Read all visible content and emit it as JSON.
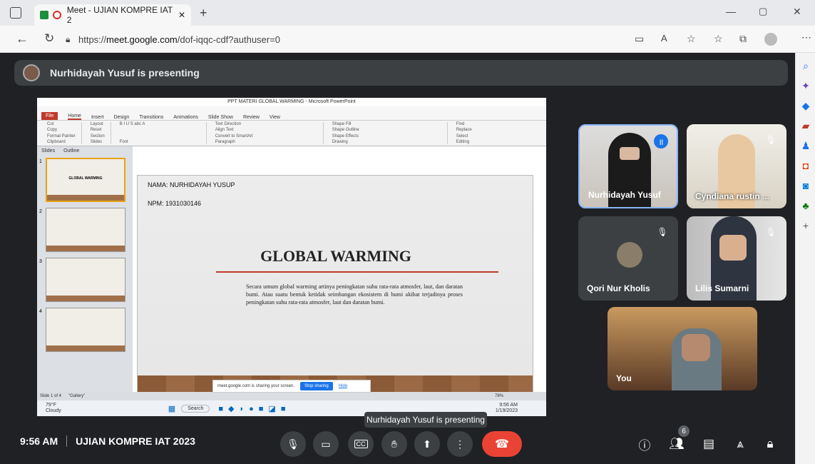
{
  "browser": {
    "tab_title": "Meet - UJIAN KOMPRE IAT 2",
    "url_prefix": "https://",
    "url_domain": "meet.google.com",
    "url_path": "/dof-iqqc-cdf?authuser=0"
  },
  "meet": {
    "presenter_banner": "Nurhidayah Yusuf is presenting",
    "time": "9:56 AM",
    "meeting_name": "UJIAN KOMPRE IAT 2023",
    "tooltip": "Nurhidayah Yusuf is presenting",
    "people_count": "6"
  },
  "participants": [
    {
      "name": "Nurhidayah Yusuf"
    },
    {
      "name": "Cyndiana rustin ..."
    },
    {
      "name": "Qori Nur Kholis"
    },
    {
      "name": "Lilis Sumarni"
    },
    {
      "name": "You"
    }
  ],
  "ppt": {
    "window_title": "PPT MATERI GLOBAL WARMING - Microsoft PowerPoint",
    "tabs": [
      "File",
      "Home",
      "Insert",
      "Design",
      "Transitions",
      "Animations",
      "Slide Show",
      "Review",
      "View"
    ],
    "groups": [
      "Clipboard",
      "Slides",
      "Font",
      "Paragraph",
      "Drawing",
      "Editing"
    ],
    "clipboard": [
      "Cut",
      "Copy",
      "Format Painter",
      "Paste"
    ],
    "slides_btns": [
      "Layout",
      "Reset",
      "Section",
      "New Slide"
    ],
    "drawing": [
      "Shape Fill",
      "Shape Outline",
      "Shape Effects",
      "Arrange",
      "Quick Styles"
    ],
    "editing": [
      "Find",
      "Replace",
      "Select"
    ],
    "paragraph": [
      "Text Direction",
      "Align Text",
      "Convert to SmartArt"
    ],
    "pane_tabs": [
      "Slides",
      "Outline"
    ],
    "slide_nums": [
      "1",
      "2",
      "3",
      "4"
    ],
    "thumb1_title": "GLOBAL WARMING",
    "slide_name": "NAMA: NURHIDAYAH YUSUP",
    "slide_npm": "NPM: 1931030146",
    "slide_title": "GLOBAL WARMING",
    "slide_body": "Secara umum global warming artinya peningkatan suhu rata-rata atmosfer, laut, dan daratan bumi. Atau suatu bentuk ketidak seimbangan ekosistem di bumi akibat terjadinya proses peningkatan suhu rata-rata atmosfer, laut dan daratan bumi.",
    "status_slide": "Slide 1 of 4",
    "status_theme": "\"Gallery\"",
    "zoom": "78%",
    "share_text": "meet.google.com is sharing your screen.",
    "stop_sharing": "Stop sharing",
    "hide": "Hide",
    "weather_temp": "79°F",
    "weather_desc": "Cloudy",
    "search": "Search",
    "clock_time": "9:56 AM",
    "clock_date": "1/19/2023"
  },
  "colors": {
    "end_call": "#ea4335",
    "accent": "#1a73e8",
    "bg": "#202124"
  }
}
